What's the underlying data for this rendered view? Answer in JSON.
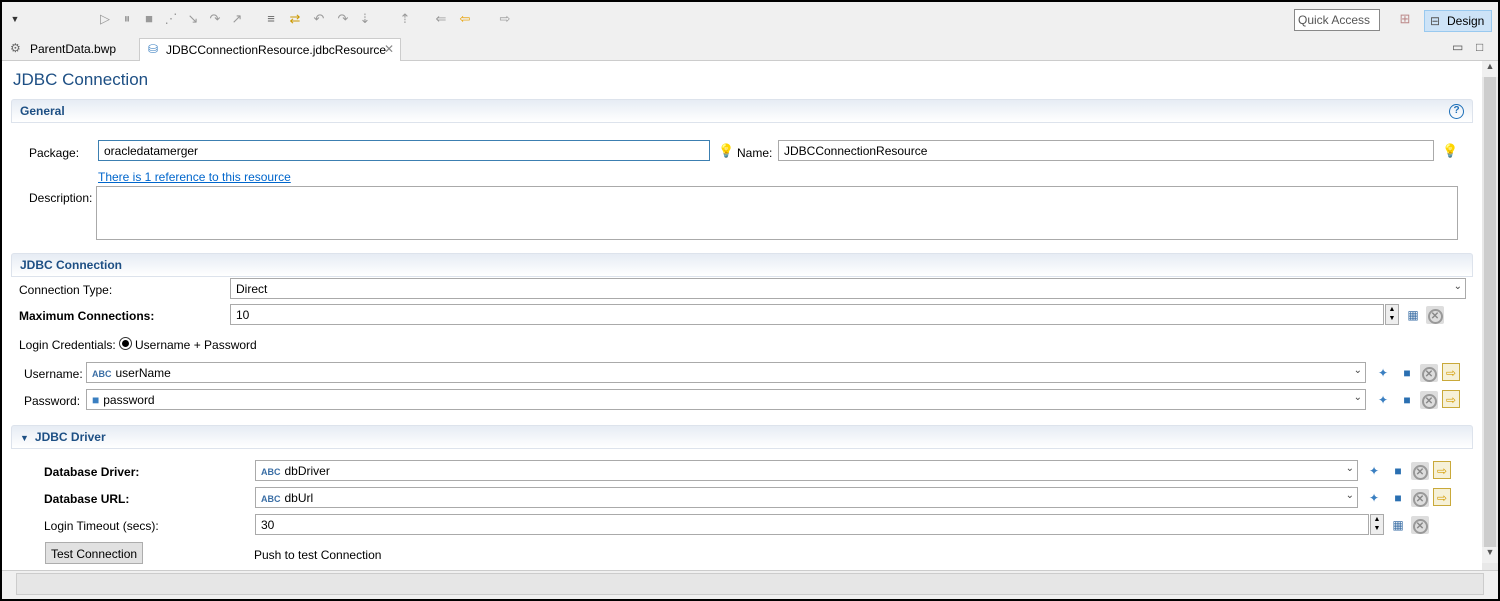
{
  "toolbar": {
    "quick_access": "Quick Access",
    "design": "Design"
  },
  "tabs": [
    {
      "label": "ParentData.bwp"
    },
    {
      "label": "JDBCConnectionResource.jdbcResource"
    }
  ],
  "editor": {
    "title": "JDBC Connection",
    "general": {
      "header": "General",
      "package_label": "Package:",
      "package_value": "oracledatamerger",
      "name_label": "Name:",
      "name_value": "JDBCConnectionResource",
      "reference_link": "There is 1 reference to this resource",
      "description_label": "Description:",
      "description_value": ""
    },
    "jdbc_connection": {
      "header": "JDBC Connection",
      "connection_type_label": "Connection Type:",
      "connection_type_value": "Direct",
      "max_connections_label": "Maximum Connections:",
      "max_connections_value": "10",
      "login_credentials_label": "Login Credentials:",
      "login_credentials_option": "Username + Password",
      "username_label": "Username:",
      "username_value": "userName",
      "password_label": "Password:",
      "password_value": "password"
    },
    "jdbc_driver": {
      "header": "JDBC Driver",
      "driver_label": "Database Driver:",
      "driver_value": "dbDriver",
      "url_label": "Database URL:",
      "url_value": "dbUrl",
      "timeout_label": "Login Timeout (secs):",
      "timeout_value": "30",
      "test_button": "Test Connection",
      "test_hint": "Push to test Connection"
    }
  }
}
